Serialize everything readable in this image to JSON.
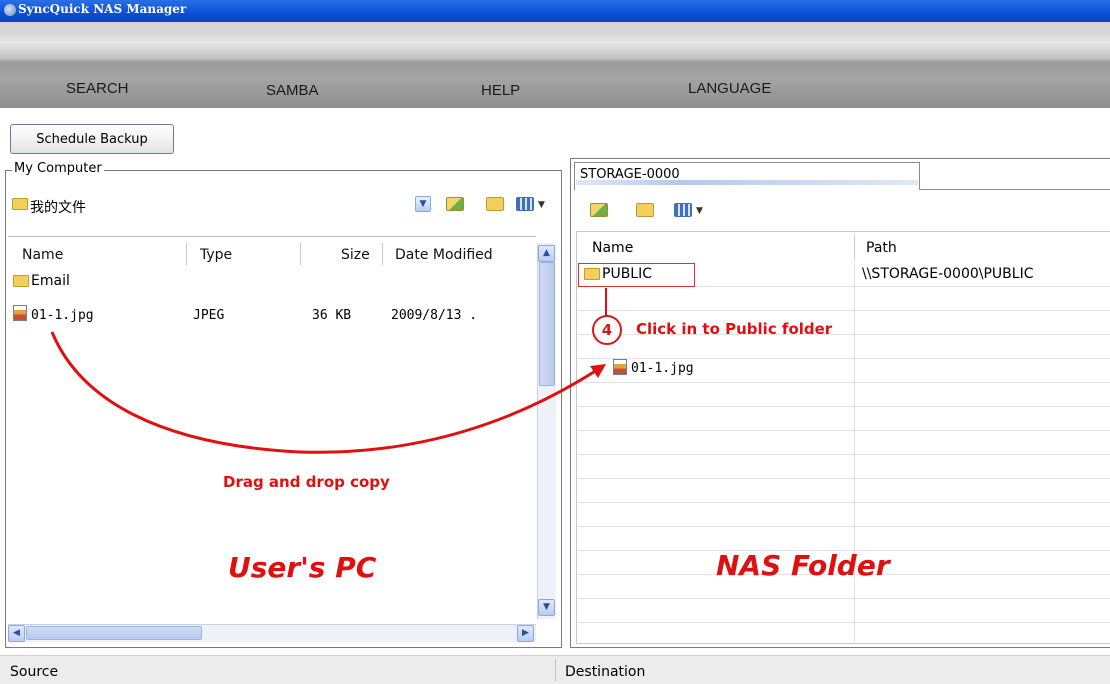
{
  "window": {
    "title": "SyncQuick NAS Manager",
    "icon": "app-icon"
  },
  "menu": {
    "items": [
      "SEARCH",
      "SAMBA",
      "HELP",
      "LANGUAGE"
    ]
  },
  "toolbar": {
    "schedule_backup_label": "Schedule Backup"
  },
  "left_panel": {
    "group_label": "My Computer",
    "address_value": "我的文件",
    "icons": [
      "folder-up-icon",
      "new-folder-icon",
      "view-options-icon"
    ],
    "columns": [
      "Name",
      "Type",
      "Size",
      "Date Modified"
    ],
    "rows": [
      {
        "name": "Email",
        "type": "",
        "size": "",
        "date": "",
        "icon": "folder-icon"
      },
      {
        "name": "01-1.jpg",
        "type": "JPEG",
        "size": "36 KB",
        "date": "2009/8/13 .",
        "icon": "image-file-icon"
      }
    ]
  },
  "right_panel": {
    "tab_label": "STORAGE-0000",
    "icons": [
      "folder-up-icon",
      "new-folder-icon",
      "view-options-icon"
    ],
    "columns": [
      "Name",
      "Path"
    ],
    "rows": [
      {
        "name": "PUBLIC",
        "path": "\\\\STORAGE-0000\\PUBLIC",
        "icon": "folder-icon"
      },
      {
        "name": "01-1.jpg",
        "path": "",
        "icon": "image-file-icon"
      }
    ]
  },
  "annotations": {
    "step_number": "4",
    "step_text": "Click in to Public folder",
    "drag_text": "Drag and drop copy",
    "left_caption": "User's PC",
    "right_caption": "NAS Folder",
    "color": "#e01010"
  },
  "statusbar": {
    "source_label": "Source",
    "destination_label": "Destination"
  }
}
